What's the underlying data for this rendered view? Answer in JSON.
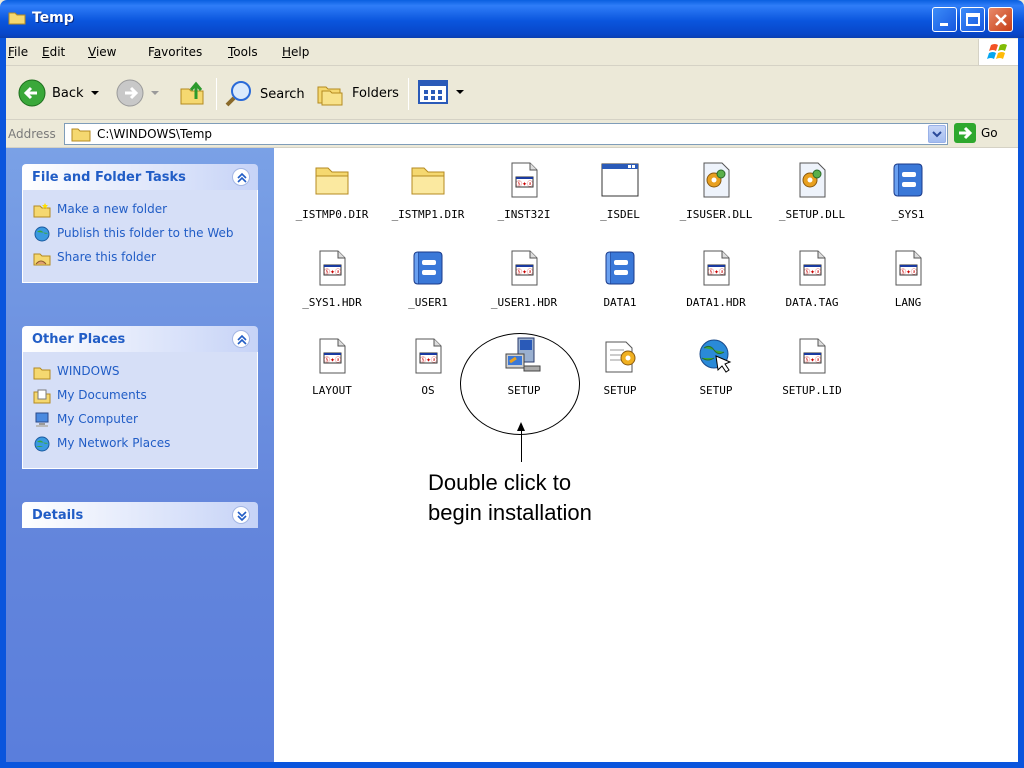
{
  "window": {
    "title": "Temp"
  },
  "menu": [
    {
      "label": "File",
      "accel": "F"
    },
    {
      "label": "Edit",
      "accel": "E"
    },
    {
      "label": "View",
      "accel": "V"
    },
    {
      "label": "Favorites",
      "accel": "a"
    },
    {
      "label": "Tools",
      "accel": "T"
    },
    {
      "label": "Help",
      "accel": "H"
    }
  ],
  "toolbar": {
    "back": "Back",
    "search": "Search",
    "folders": "Folders"
  },
  "address": {
    "label": "Address",
    "path": "C:\\WINDOWS\\Temp",
    "go": "Go"
  },
  "sidebar": {
    "tasks": {
      "title": "File and Folder Tasks",
      "items": [
        "Make a new folder",
        "Publish this folder to the Web",
        "Share this folder"
      ]
    },
    "places": {
      "title": "Other Places",
      "items": [
        "WINDOWS",
        "My Documents",
        "My Computer",
        "My Network Places"
      ]
    },
    "details": {
      "title": "Details"
    }
  },
  "files": [
    {
      "name": "_ISTMP0.DIR",
      "icon": "folder-icon"
    },
    {
      "name": "_ISTMP1.DIR",
      "icon": "folder-icon"
    },
    {
      "name": "_INST32I",
      "icon": "document-icon"
    },
    {
      "name": "_ISDEL",
      "icon": "application-window-icon"
    },
    {
      "name": "_ISUSER.DLL",
      "icon": "dll-gear-icon"
    },
    {
      "name": "_SETUP.DLL",
      "icon": "dll-gear-icon"
    },
    {
      "name": "_SYS1",
      "icon": "cabinet-icon"
    },
    {
      "name": "_SYS1.HDR",
      "icon": "document-icon"
    },
    {
      "name": "_USER1",
      "icon": "cabinet-icon"
    },
    {
      "name": "_USER1.HDR",
      "icon": "document-icon"
    },
    {
      "name": "DATA1",
      "icon": "cabinet-icon"
    },
    {
      "name": "DATA1.HDR",
      "icon": "document-icon"
    },
    {
      "name": "DATA.TAG",
      "icon": "document-icon"
    },
    {
      "name": "LANG",
      "icon": "document-icon"
    },
    {
      "name": "LAYOUT",
      "icon": "document-icon"
    },
    {
      "name": "OS",
      "icon": "document-icon"
    },
    {
      "name": "SETUP",
      "icon": "setup-computer-icon"
    },
    {
      "name": "SETUP",
      "icon": "setup-config-icon"
    },
    {
      "name": "SETUP",
      "icon": "setup-globe-icon"
    },
    {
      "name": "SETUP.LID",
      "icon": "document-icon"
    }
  ],
  "callout": {
    "line1": "Double click to",
    "line2": "begin installation"
  }
}
